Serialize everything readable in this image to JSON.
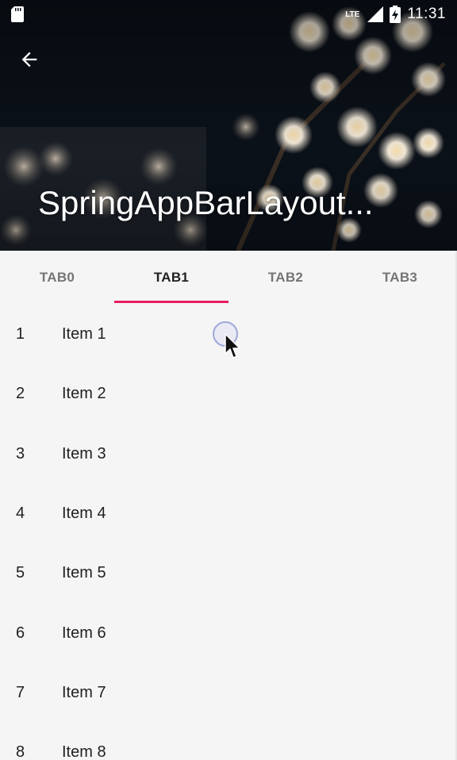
{
  "status_bar": {
    "network": "LTE",
    "time": "11:31",
    "icons": [
      "sd-card-icon",
      "signal-icon",
      "battery-charging-icon"
    ]
  },
  "app_bar": {
    "back_icon": "arrow-back-icon",
    "title": "SpringAppBarLayout..."
  },
  "tabs": [
    {
      "label": "TAB0",
      "active": false
    },
    {
      "label": "TAB1",
      "active": true
    },
    {
      "label": "TAB2",
      "active": false
    },
    {
      "label": "TAB3",
      "active": false
    }
  ],
  "list": {
    "items": [
      {
        "num": "1",
        "label": "Item 1"
      },
      {
        "num": "2",
        "label": "Item 2"
      },
      {
        "num": "3",
        "label": "Item 3"
      },
      {
        "num": "4",
        "label": "Item 4"
      },
      {
        "num": "5",
        "label": "Item 5"
      },
      {
        "num": "6",
        "label": "Item 6"
      },
      {
        "num": "7",
        "label": "Item 7"
      },
      {
        "num": "8",
        "label": "Item 8"
      }
    ]
  },
  "colors": {
    "tab_indicator": "#e91e63",
    "background": "#f5f5f5",
    "header_dark": "#0a0f16"
  }
}
